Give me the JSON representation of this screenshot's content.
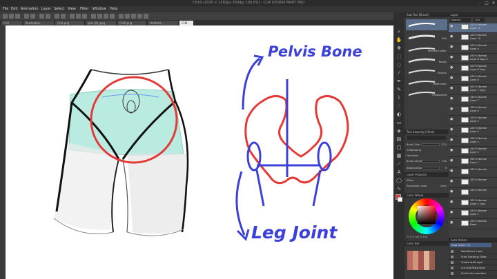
{
  "window": {
    "title": "CH10 (2020 × 1282px 350dpi 100.0%) - CLIP STUDIO PAINT PRO"
  },
  "menu": [
    "File",
    "Edit",
    "Animation",
    "Layer",
    "Select",
    "View",
    "Filter",
    "Window",
    "Help"
  ],
  "tabs": [
    {
      "label": "CH1"
    },
    {
      "label": "Illustration"
    },
    {
      "label": "CH4.png"
    },
    {
      "label": "spin (8).jpeg"
    },
    {
      "label": "CH5f.png"
    },
    {
      "label": "Untitled..."
    },
    {
      "label": "CH8"
    }
  ],
  "canvas": {
    "annotation_top": "Pelvis Bone",
    "annotation_bottom": "Leg Joint",
    "colors": {
      "ink": "#3a40d8",
      "bone": "#e53935",
      "outline": "#111111",
      "teal": "#b9ebe0"
    }
  },
  "sub_tool": {
    "header": "Sub Tool [Brush]",
    "brushes": [
      {
        "label": "Soft"
      },
      {
        "label": "Rounded water"
      },
      {
        "label": "Rough"
      },
      {
        "label": "Viscous"
      },
      {
        "label": "Watercolor"
      },
      {
        "label": "Unsplashed"
      }
    ]
  },
  "tool_property": {
    "header": "Tool property [Hard]",
    "rows": [
      {
        "label": "Brush Size",
        "value": "17.0"
      },
      {
        "label": "Antialiasing",
        "value": ""
      },
      {
        "label": "Hardness",
        "value": ""
      },
      {
        "label": "Brush density",
        "value": "100"
      },
      {
        "label": "Stabilization",
        "value": "0"
      }
    ],
    "layer_property": "Layer Property",
    "effect": "Effect",
    "expression_color": "Expression color",
    "color_value": "Color"
  },
  "color": {
    "header": "Color Wheel",
    "hsv": "H 0 S 100 V 100"
  },
  "layer": {
    "header": "Layer",
    "blend": "Normal",
    "opacity": "100",
    "layers": [
      {
        "name": "100 % Normal",
        "sub": "Layer 11",
        "selected": true
      },
      {
        "name": "100 % Normal",
        "sub": "Layer 10"
      },
      {
        "name": "100 % Normal",
        "sub": "Layer 9"
      },
      {
        "name": "100 % Normal",
        "sub": "Layer 8 Copy 2"
      },
      {
        "name": "100 % Normal",
        "sub": "Layer 8 Copy"
      },
      {
        "name": "100 % Normal",
        "sub": "Layer 8"
      },
      {
        "name": "100 % Normal",
        "sub": "Layer 7 Copy"
      },
      {
        "name": "100 % Normal",
        "sub": "Layer 7"
      },
      {
        "name": "100 % Normal",
        "sub": "Layer 6"
      },
      {
        "name": "100 % Normal",
        "sub": "Layer 5"
      },
      {
        "name": "100 % Normal",
        "sub": "Layer 4"
      },
      {
        "name": "100 % Normal",
        "sub": "Layer 3"
      },
      {
        "name": "100 % Normal",
        "sub": "Layer 2"
      },
      {
        "name": "100 % Normal",
        "sub": "Layer 1"
      },
      {
        "name": "100 % Normal",
        "sub": ""
      },
      {
        "name": "100 % Normal",
        "sub": ""
      },
      {
        "name": "100 % Normal",
        "sub": ""
      },
      {
        "name": "100 % Normal",
        "sub": "Layer 1 Copy"
      },
      {
        "name": "100 % Normal",
        "sub": "Layer 1"
      },
      {
        "name": "100 % Normal",
        "sub": "Paper"
      }
    ]
  },
  "material": {
    "header": "Color Set"
  },
  "auto_action": {
    "header": "Auto Action",
    "set": "Auto Action (1)",
    "items": [
      {
        "label": "New Raster Layer"
      },
      {
        "label": "Start Drawing: Draw"
      },
      {
        "label": "Create draft layer"
      },
      {
        "label": "Cut and Paste layer"
      },
      {
        "label": "Shrink the selection"
      }
    ]
  }
}
